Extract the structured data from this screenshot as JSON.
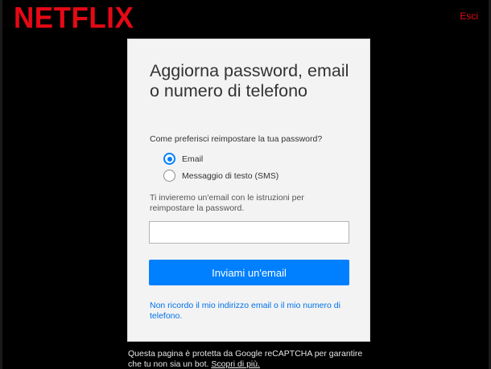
{
  "header": {
    "logo_text": "NETFLIX",
    "signout_label": "Esci"
  },
  "card": {
    "title": "Aggiorna password, email o numero di telefono",
    "question": "Come preferisci reimpostare la tua password?",
    "options": [
      {
        "label": "Email",
        "selected": true
      },
      {
        "label": "Messaggio di testo (SMS)",
        "selected": false
      }
    ],
    "info": "Ti invieremo un'email con le istruzioni per reimpostare la password.",
    "email_value": "",
    "submit_label": "Inviami un'email",
    "help_link": "Non ricordo il mio indirizzo email o il mio numero di telefono."
  },
  "footer": {
    "recaptcha_text": "Questa pagina è protetta da Google reCAPTCHA per garantire che tu non sia un bot.",
    "learn_more": "Scopri di più."
  },
  "colors": {
    "brand": "#e50914",
    "accent": "#0080ff",
    "link": "#0071eb"
  }
}
